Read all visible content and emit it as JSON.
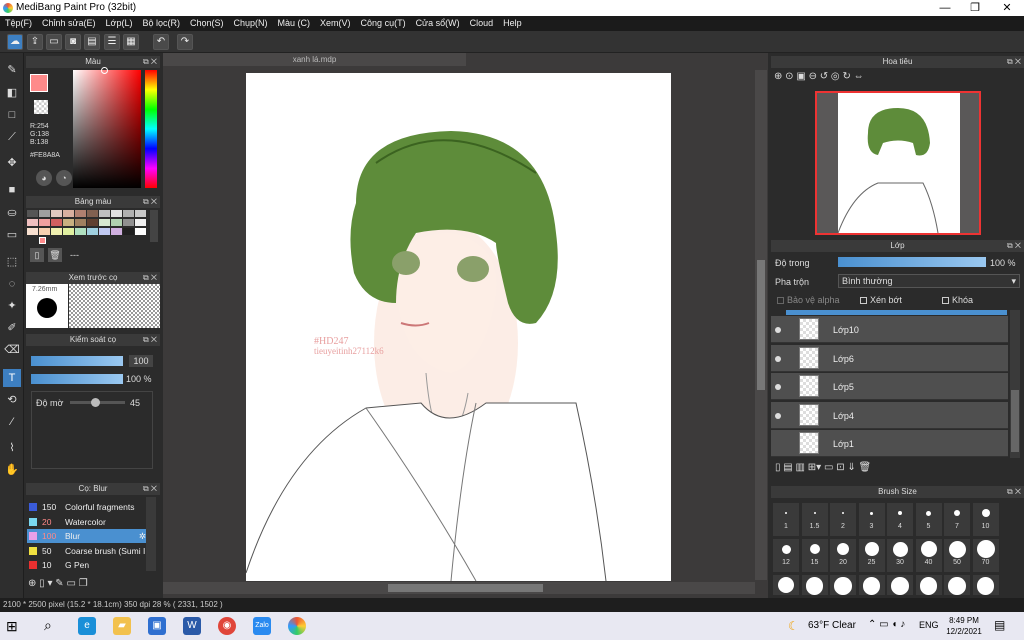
{
  "window": {
    "title": "MediBang Paint Pro (32bit)",
    "min": "—",
    "max": "❐",
    "close": "✕"
  },
  "menu": [
    "Tệp(F)",
    "Chỉnh sửa(E)",
    "Lớp(L)",
    "Bộ lọc(R)",
    "Chọn(S)",
    "Chụp(N)",
    "Màu (C)",
    "Xem(V)",
    "Công cụ(T)",
    "Cửa sổ(W)",
    "Cloud",
    "Help"
  ],
  "color_panel": {
    "title": "Màu",
    "r": "R:254",
    "g": "G:138",
    "b": "B:138",
    "hex": "#FE8A8A",
    "fg": "#fe8a8a"
  },
  "palette_panel": {
    "title": "Bảng màu",
    "dash": "---"
  },
  "preview_panel": {
    "title": "Xem trước cọ",
    "size": "7.26mm"
  },
  "brush_control": {
    "title": "Kiểm soát cọ",
    "size_val": "100",
    "opacity_val": "100 %",
    "blur_label": "Độ mờ",
    "blur_val": "45",
    "blur_level": 0.45
  },
  "brush_panel": {
    "title": "Cọ: Blur",
    "items": [
      {
        "n": "150",
        "l": "Colorful fragments",
        "c": "#3a5bd9"
      },
      {
        "n": "20",
        "l": "Watercolor",
        "c": "#7ad8f0"
      },
      {
        "n": "100",
        "l": "Blur",
        "c": "#e8a0e8",
        "active": true
      },
      {
        "n": "50",
        "l": "Coarse brush (Sumi I",
        "c": "#f0e040"
      },
      {
        "n": "10",
        "l": "G Pen",
        "c": "#e83030"
      }
    ]
  },
  "canvas": {
    "tab": "xanh lá.mdp",
    "watermark1": "#HD247",
    "watermark2": "tieuyeitinh27112k6"
  },
  "navigator": {
    "title": "Hoa tiêu"
  },
  "layers": {
    "title": "Lớp",
    "opacity_label": "Độ trong",
    "opacity_val": "100 %",
    "opacity_level": 1,
    "blend_label": "Pha trộn",
    "blend_val": "Bình thường",
    "protect": "Bảo vệ alpha",
    "clip": "Xén bớt",
    "lock": "Khóa",
    "items": [
      "Lớp10",
      "Lớp6",
      "Lớp5",
      "Lớp4",
      "Lớp1"
    ]
  },
  "brush_size": {
    "title": "Brush Size",
    "row1": [
      "1",
      "1.5",
      "2",
      "3",
      "4",
      "5",
      "7",
      "10"
    ],
    "row2": [
      "12",
      "15",
      "20",
      "25",
      "30",
      "40",
      "50",
      "70"
    ]
  },
  "status": "2100 * 2500 pixel  (15.2 * 18.1cm)  350 dpi  28 %  ( 2331, 1502 )",
  "taskbar": {
    "weather": "63°F  Clear",
    "lang": "ENG",
    "time": "8:49 PM",
    "date": "12/2/2021"
  }
}
